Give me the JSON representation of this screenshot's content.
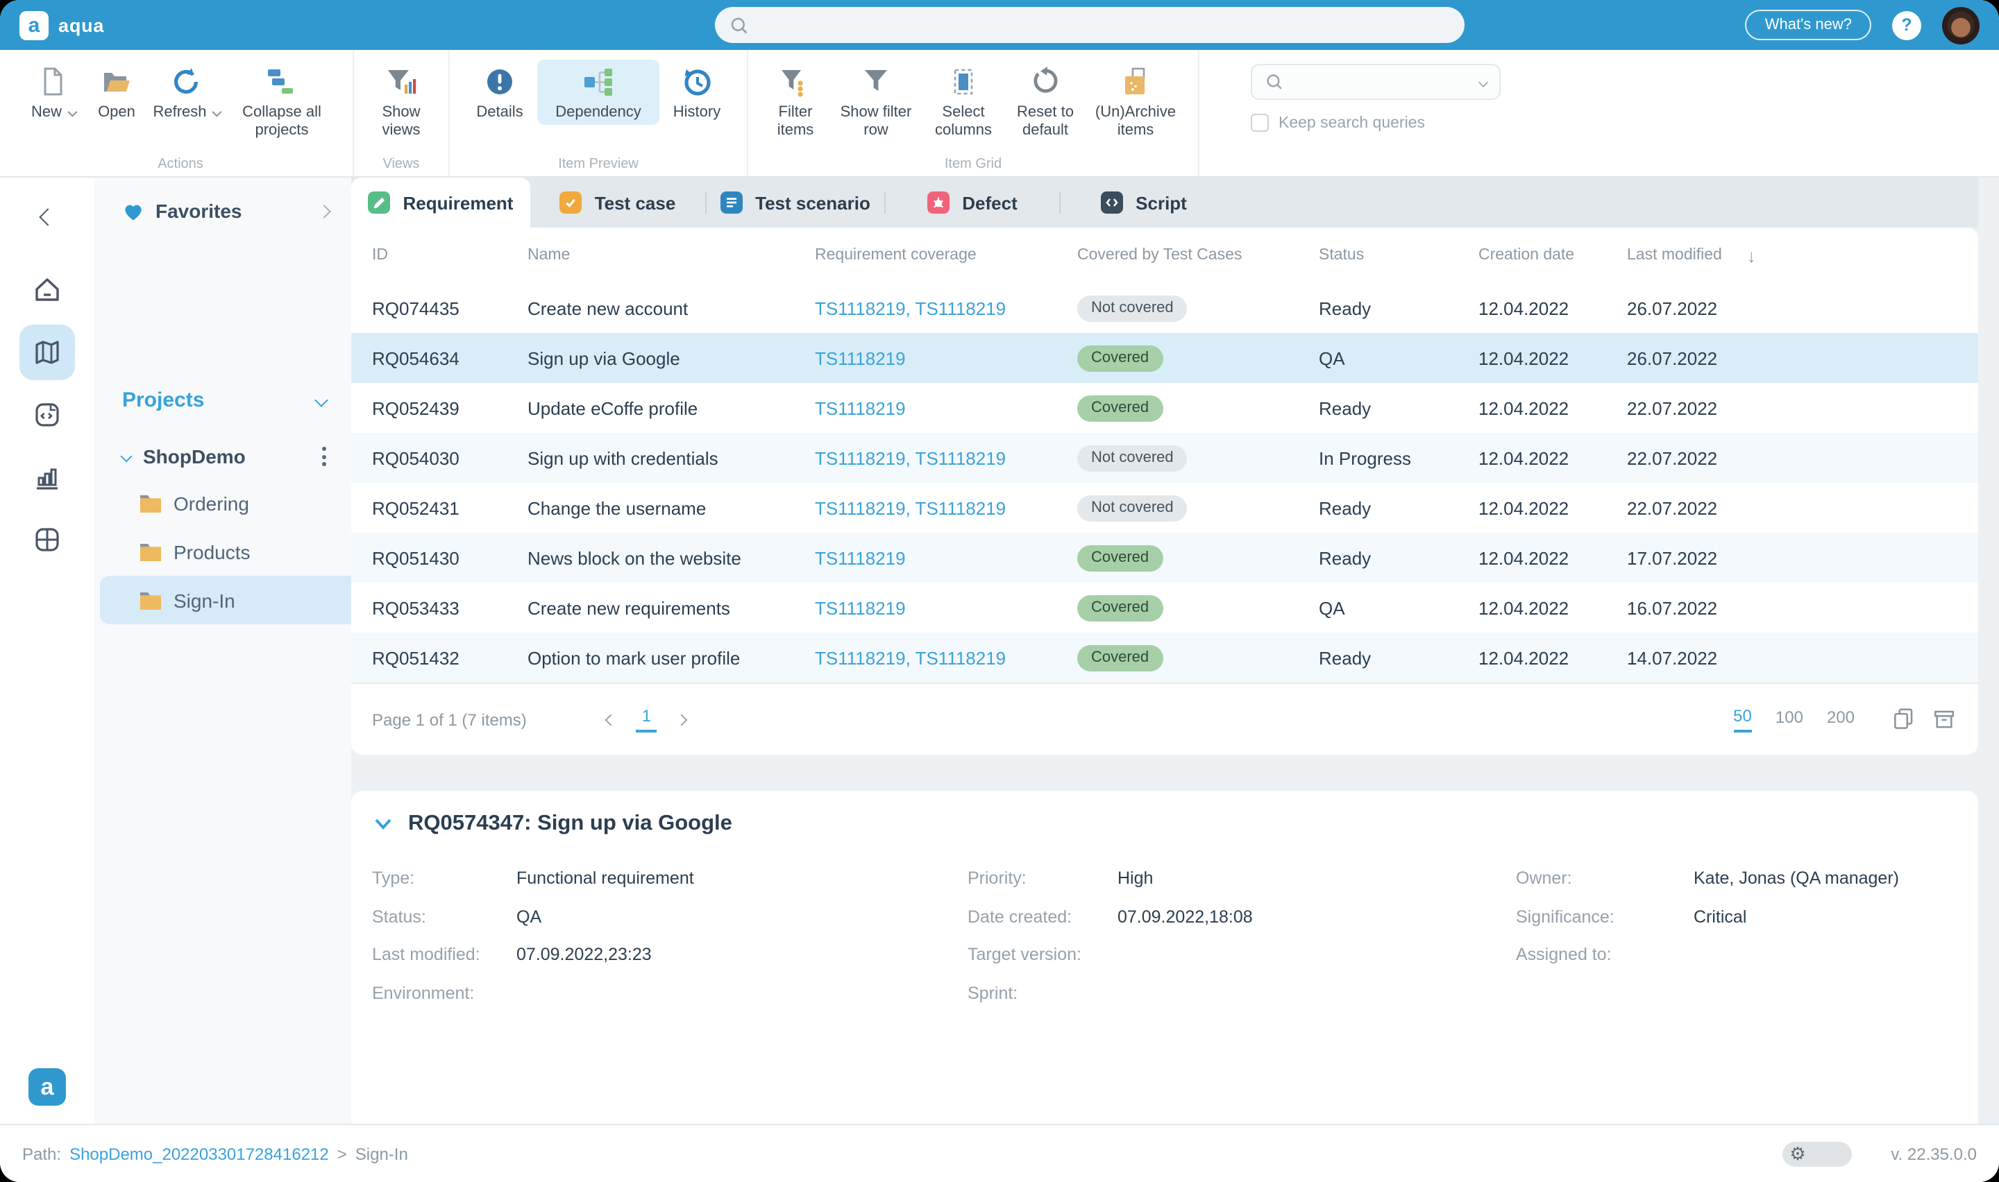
{
  "colors": {
    "accent": "#2f99cf",
    "link": "#3aa3da",
    "covered_bg": "#a6cfa8",
    "not_covered_bg": "#e4e8ea",
    "selection_bg": "#d9edf8"
  },
  "topbar": {
    "brand": "aqua",
    "whats_new": "What's new?",
    "help": "?",
    "search_value": ""
  },
  "ribbon": {
    "groups": [
      {
        "label": "Actions",
        "buttons": [
          {
            "label": "New"
          },
          {
            "label": "Open"
          },
          {
            "label": "Refresh"
          },
          {
            "label": "Collapse all projects"
          }
        ]
      },
      {
        "label": "Views",
        "buttons": [
          {
            "label": "Show views"
          }
        ]
      },
      {
        "label": "Item Preview",
        "buttons": [
          {
            "label": "Details"
          },
          {
            "label": "Dependency"
          },
          {
            "label": "History"
          }
        ]
      },
      {
        "label": "Item Grid",
        "buttons": [
          {
            "label": "Filter items"
          },
          {
            "label": "Show filter row"
          },
          {
            "label": "Select columns"
          },
          {
            "label": "Reset to default"
          },
          {
            "label": "(Un)Archive items"
          }
        ]
      }
    ],
    "search_value": "",
    "keep_label": "Keep search queries"
  },
  "sidebar": {
    "favorites_label": "Favorites",
    "projects_label": "Projects",
    "project_name": "ShopDemo",
    "folders": [
      "Ordering",
      "Products",
      "Sign-In"
    ],
    "selected_folder": "Sign-In"
  },
  "tabs": [
    {
      "label": "Requirement"
    },
    {
      "label": "Test case"
    },
    {
      "label": "Test scenario"
    },
    {
      "label": "Defect"
    },
    {
      "label": "Script"
    }
  ],
  "table": {
    "columns": [
      "ID",
      "Name",
      "Requirement coverage",
      "Covered by Test Cases",
      "Status",
      "Creation date",
      "Last modified"
    ],
    "rows": [
      {
        "id": "RQ074435",
        "name": "Create new account",
        "coverage": "TS1118219, TS1118219",
        "covered": "Not covered",
        "status": "Ready",
        "created": "12.04.2022",
        "modified": "26.07.2022"
      },
      {
        "id": "RQ054634",
        "name": "Sign up via Google",
        "coverage": "TS1118219",
        "covered": "Covered",
        "status": "QA",
        "created": "12.04.2022",
        "modified": "26.07.2022"
      },
      {
        "id": "RQ052439",
        "name": "Update eCoffe profile",
        "coverage": "TS1118219",
        "covered": "Covered",
        "status": "Ready",
        "created": "12.04.2022",
        "modified": "22.07.2022"
      },
      {
        "id": "RQ054030",
        "name": "Sign up with credentials",
        "coverage": "TS1118219, TS1118219",
        "covered": "Not covered",
        "status": "In Progress",
        "created": "12.04.2022",
        "modified": "22.07.2022"
      },
      {
        "id": "RQ052431",
        "name": "Change the username",
        "coverage": "TS1118219, TS1118219",
        "covered": "Not covered",
        "status": "Ready",
        "created": "12.04.2022",
        "modified": "22.07.2022"
      },
      {
        "id": "RQ051430",
        "name": "News block on the website",
        "coverage": "TS1118219",
        "covered": "Covered",
        "status": "Ready",
        "created": "12.04.2022",
        "modified": "17.07.2022"
      },
      {
        "id": "RQ053433",
        "name": "Create new requirements",
        "coverage": "TS1118219",
        "covered": "Covered",
        "status": "QA",
        "created": "12.04.2022",
        "modified": "16.07.2022"
      },
      {
        "id": "RQ051432",
        "name": "Option to mark user profile",
        "coverage": "TS1118219, TS1118219",
        "covered": "Covered",
        "status": "Ready",
        "created": "12.04.2022",
        "modified": "14.07.2022"
      }
    ]
  },
  "pagination": {
    "summary": "Page 1 of 1 (7 items)",
    "page": "1",
    "sizes": [
      "50",
      "100",
      "200"
    ],
    "active_size": "50"
  },
  "detail": {
    "title": "RQ0574347: Sign up via Google",
    "col1": [
      {
        "label": "Type:",
        "value": "Functional requirement"
      },
      {
        "label": "Status:",
        "value": "QA"
      },
      {
        "label": "Last modified:",
        "value": "07.09.2022,23:23"
      },
      {
        "label": "Environment:",
        "value": ""
      }
    ],
    "col2": [
      {
        "label": "Priority:",
        "value": "High"
      },
      {
        "label": "Date created:",
        "value": "07.09.2022,18:08"
      },
      {
        "label": "Target version:",
        "value": ""
      },
      {
        "label": "Sprint:",
        "value": ""
      }
    ],
    "col3": [
      {
        "label": "Owner:",
        "value": "Kate, Jonas (QA manager)"
      },
      {
        "label": "Significance:",
        "value": "Critical"
      },
      {
        "label": "Assigned to:",
        "value": ""
      }
    ]
  },
  "statusbar": {
    "path_label": "Path:",
    "path_link": "ShopDemo_202203301728416212",
    "path_sep": ">",
    "path_current": "Sign-In",
    "version": "v. 22.35.0.0"
  }
}
